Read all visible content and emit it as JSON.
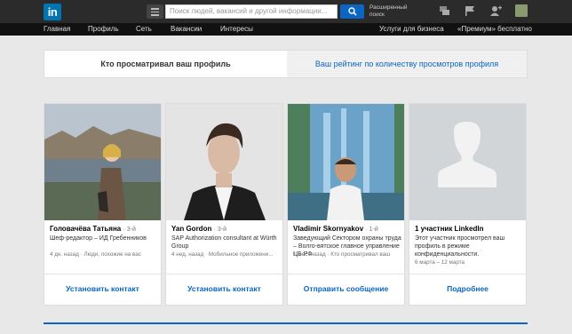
{
  "header": {
    "logo_text": "in",
    "search_placeholder": "Поиск людей, вакансий и другой информации...",
    "advanced_search_line1": "Расширенный",
    "advanced_search_line2": "поиск",
    "brand_color": "#0a66c2"
  },
  "nav": {
    "items": [
      "Главная",
      "Профиль",
      "Сеть",
      "Вакансии",
      "Интересы"
    ],
    "right_items": [
      "Услуги для бизнеса",
      "«Премиум» бесплатно"
    ]
  },
  "tabs": {
    "active": "Кто просматривал ваш профиль",
    "inactive": "Ваш рейтинг по количеству просмотров профиля"
  },
  "cards": [
    {
      "name": "Головачёва Татьяна",
      "degree": "· 3-й",
      "title": "Шеф-редактор – ИД Гребенников",
      "meta": "4 дн. назад · Люди, похожие на вас",
      "action": "Установить контакт"
    },
    {
      "name": "Yan Gordon",
      "degree": "· 3-й",
      "title": "SAP Authorization consultant at Würth Group",
      "meta": "4 нед. назад · Мобильное приложени...",
      "action": "Установить контакт"
    },
    {
      "name": "Vladimir Skornyakov",
      "degree": "· 1-й",
      "title": "Заведующий Сектором охраны труда – Волго-вятское главное управление ЦБ РФ",
      "meta": "1 мес. назад · Кто просматривал ваш",
      "action": "Отправить сообщение"
    },
    {
      "name": "1 участник LinkedIn",
      "degree": "",
      "title": "Этот участник просмотрел ваш профиль в режиме конфиденциальности.",
      "meta": "6 марта – 12 марта",
      "action": "Подробнее"
    }
  ]
}
